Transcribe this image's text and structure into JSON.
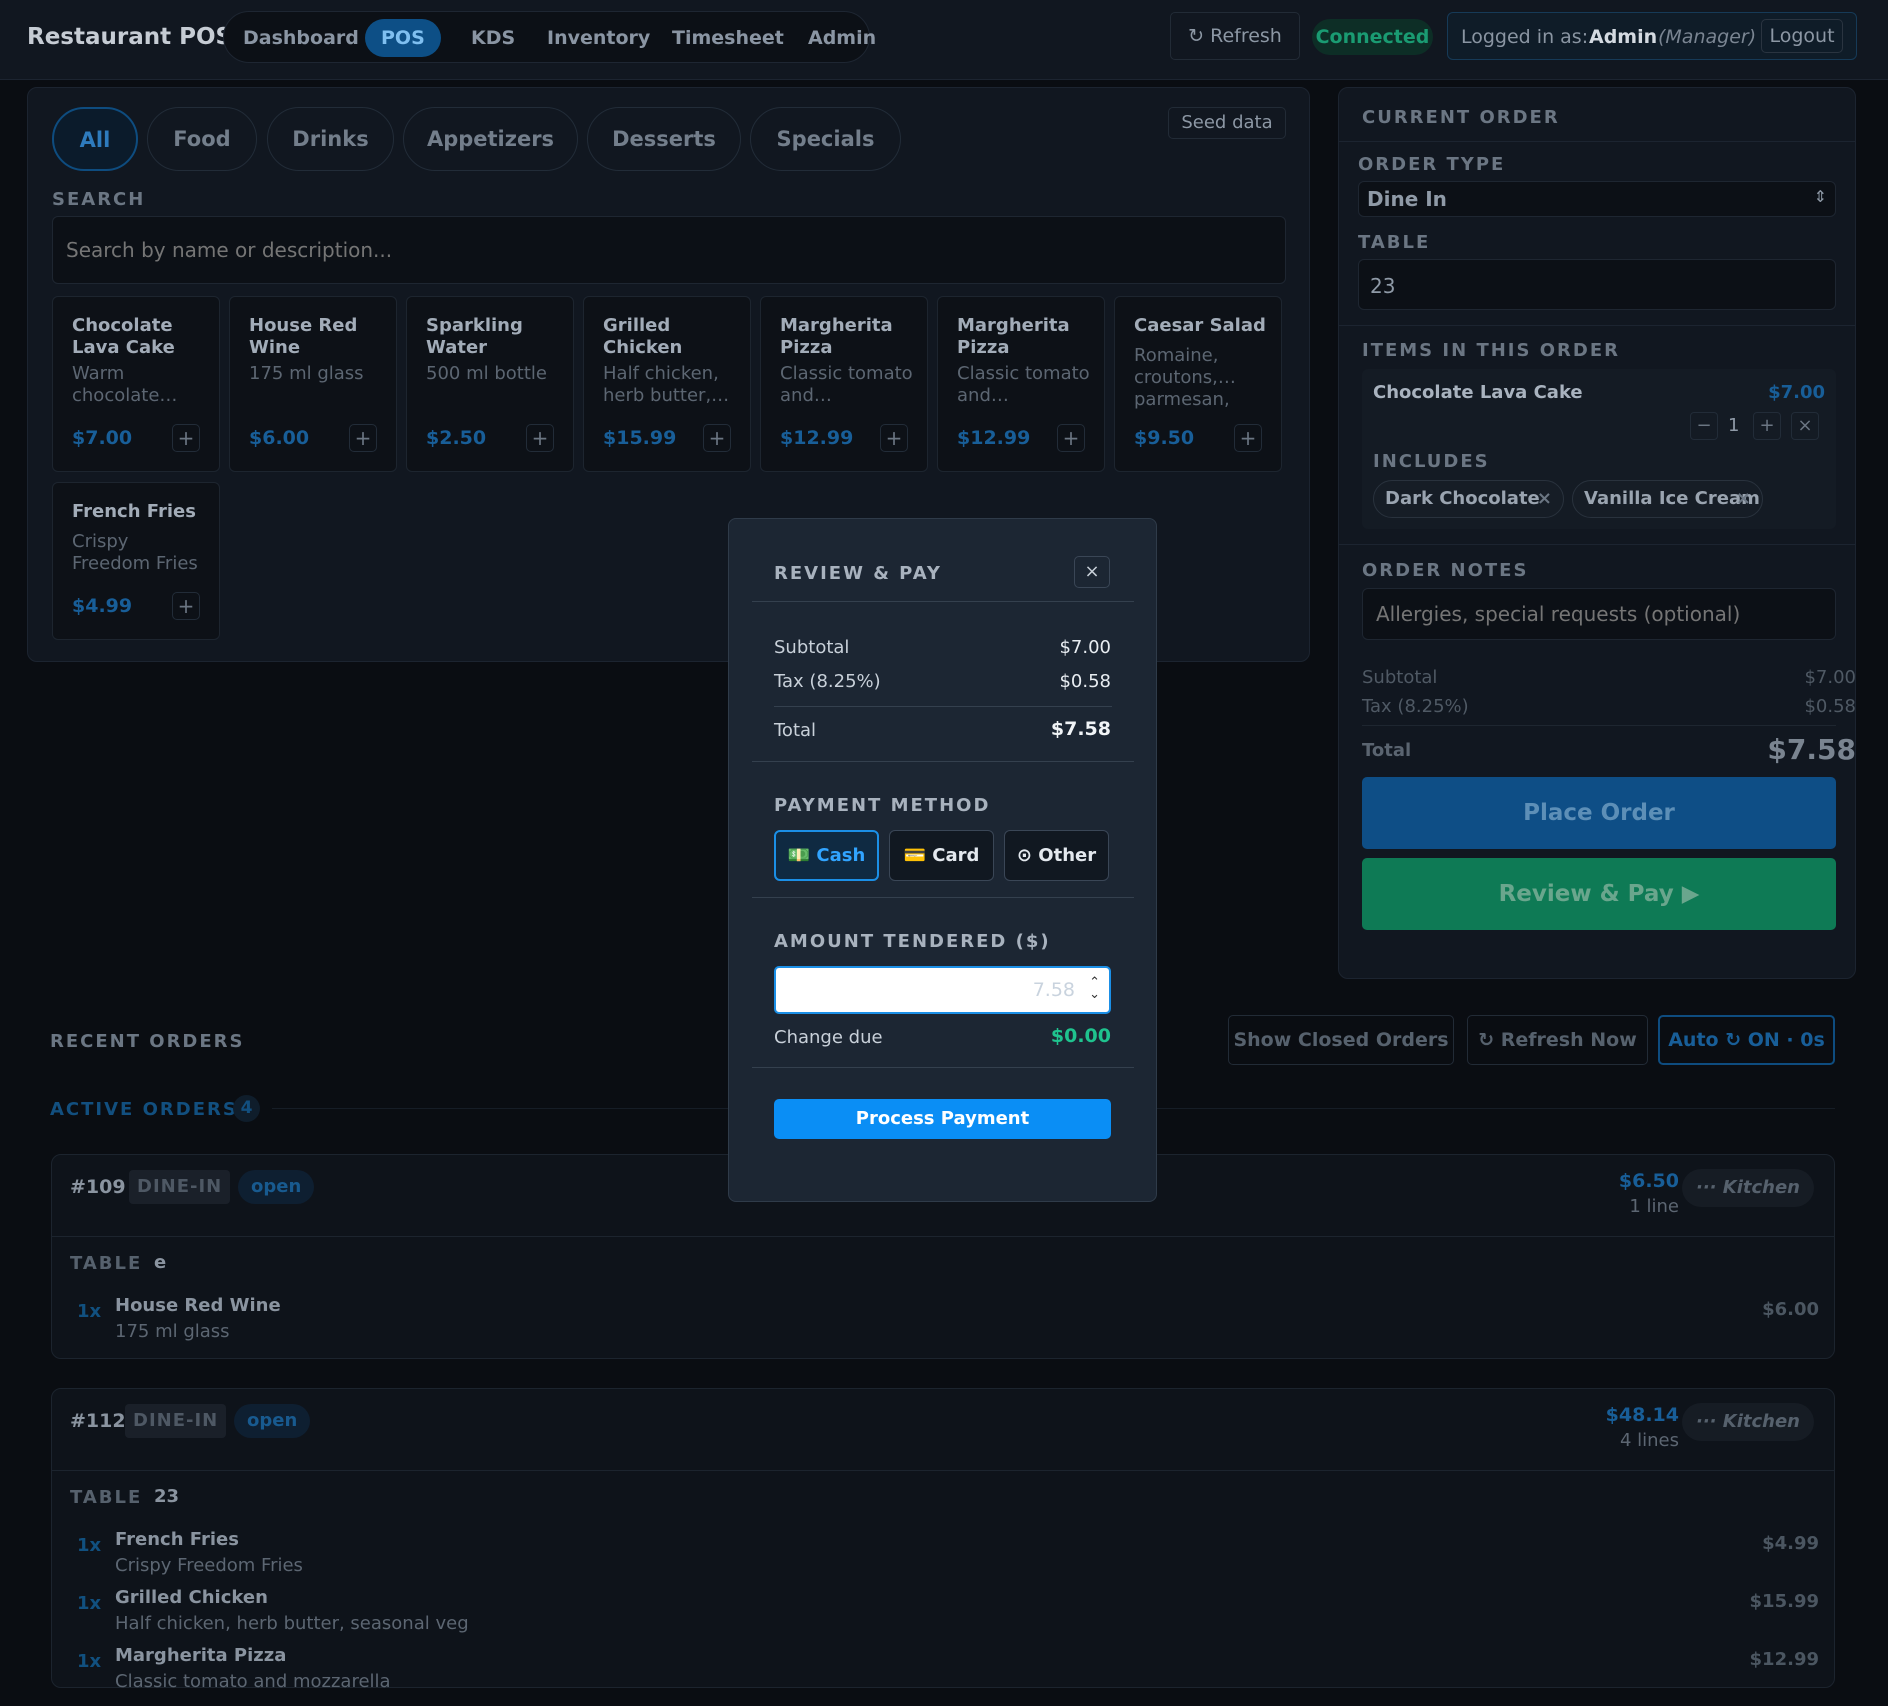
{
  "app": {
    "title": "Restaurant POS"
  },
  "nav": {
    "items": [
      "Dashboard",
      "POS",
      "KDS",
      "Inventory",
      "Timesheet",
      "Admin"
    ],
    "active": "POS"
  },
  "topbar": {
    "refresh_label": "↻ Refresh",
    "status": "Connected",
    "logged_in_prefix": "Logged in as:",
    "user": "Admin",
    "role": "(Manager)",
    "logout_label": "Logout"
  },
  "categories": {
    "items": [
      "All",
      "Food",
      "Drinks",
      "Appetizers",
      "Desserts",
      "Specials"
    ],
    "active": "All",
    "seed_label": "Seed data"
  },
  "search": {
    "label": "SEARCH",
    "placeholder": "Search by name or description..."
  },
  "menu": [
    {
      "name": "Chocolate Lava Cake",
      "desc": "Warm chocolate…",
      "price": "$7.00"
    },
    {
      "name": "House Red Wine",
      "desc": "175 ml glass",
      "price": "$6.00"
    },
    {
      "name": "Sparkling Water",
      "desc": "500 ml bottle",
      "price": "$2.50"
    },
    {
      "name": "Grilled Chicken",
      "desc": "Half chicken, herb butter,…",
      "price": "$15.99"
    },
    {
      "name": "Margherita Pizza",
      "desc": "Classic tomato and…",
      "price": "$12.99"
    },
    {
      "name": "Margherita Pizza",
      "desc": "Classic tomato and…",
      "price": "$12.99"
    },
    {
      "name": "Caesar Salad",
      "desc": "Romaine, croutons,… parmesan,",
      "price": "$9.50"
    },
    {
      "name": "French Fries",
      "desc": "Crispy Freedom Fries",
      "price": "$4.99"
    }
  ],
  "current_order": {
    "title": "CURRENT ORDER",
    "order_type_label": "ORDER TYPE",
    "order_type": "Dine In",
    "table_label": "TABLE",
    "table": "23",
    "items_label": "ITEMS IN THIS ORDER",
    "item": {
      "name": "Chocolate Lava Cake",
      "price": "$7.00",
      "qty": "1",
      "includes_label": "INCLUDES",
      "includes": [
        "Dark Chocolate",
        "Vanilla Ice Cream"
      ]
    },
    "notes_label": "ORDER NOTES",
    "notes_placeholder": "Allergies, special requests (optional)",
    "subtotal_label": "Subtotal",
    "subtotal": "$7.00",
    "tax_label": "Tax (8.25%)",
    "tax": "$0.58",
    "total_label": "Total",
    "total": "$7.58",
    "place_label": "Place Order",
    "review_label": "Review & Pay ▶"
  },
  "recent": {
    "title": "RECENT ORDERS",
    "show_closed": "Show Closed Orders",
    "refresh_now": "↻ Refresh Now",
    "auto": "Auto ↻ ON · 0s",
    "active_label": "ACTIVE ORDERS",
    "active_count": "4"
  },
  "orders": [
    {
      "id": "#109",
      "type": "DINE-IN",
      "status": "open",
      "total": "$6.50",
      "lines": "1 line",
      "kitchen": "··· Kitchen",
      "table_label": "TABLE",
      "table": "e",
      "items": [
        {
          "qty": "1x",
          "name": "House Red Wine",
          "desc": "175 ml glass",
          "price": "$6.00"
        }
      ]
    },
    {
      "id": "#112",
      "type": "DINE-IN",
      "status": "open",
      "total": "$48.14",
      "lines": "4 lines",
      "kitchen": "··· Kitchen",
      "table_label": "TABLE",
      "table": "23",
      "items": [
        {
          "qty": "1x",
          "name": "French Fries",
          "desc": "Crispy Freedom Fries",
          "price": "$4.99"
        },
        {
          "qty": "1x",
          "name": "Grilled Chicken",
          "desc": "Half chicken, herb butter, seasonal veg",
          "price": "$15.99"
        },
        {
          "qty": "1x",
          "name": "Margherita Pizza",
          "desc": "Classic tomato and mozzarella",
          "price": "$12.99"
        }
      ]
    }
  ],
  "modal": {
    "title": "REVIEW & PAY",
    "close": "×",
    "subtotal_label": "Subtotal",
    "subtotal": "$7.00",
    "tax_label": "Tax (8.25%)",
    "tax": "$0.58",
    "total_label": "Total",
    "total": "$7.58",
    "payment_label": "PAYMENT METHOD",
    "methods": [
      {
        "icon": "💵",
        "label": "Cash"
      },
      {
        "icon": "💳",
        "label": "Card"
      },
      {
        "icon": "⊙",
        "label": "Other"
      }
    ],
    "active_method": "Cash",
    "amount_label": "AMOUNT TENDERED ($)",
    "amount_placeholder": "7.58",
    "change_label": "Change due",
    "change": "$0.00",
    "process_label": "Process Payment"
  },
  "colors": {
    "accent": "#1b8fe6",
    "success": "#1fc38e",
    "place_order": "#0e4e86",
    "review_pay": "#0e7a55",
    "background": "#0a0d12"
  }
}
